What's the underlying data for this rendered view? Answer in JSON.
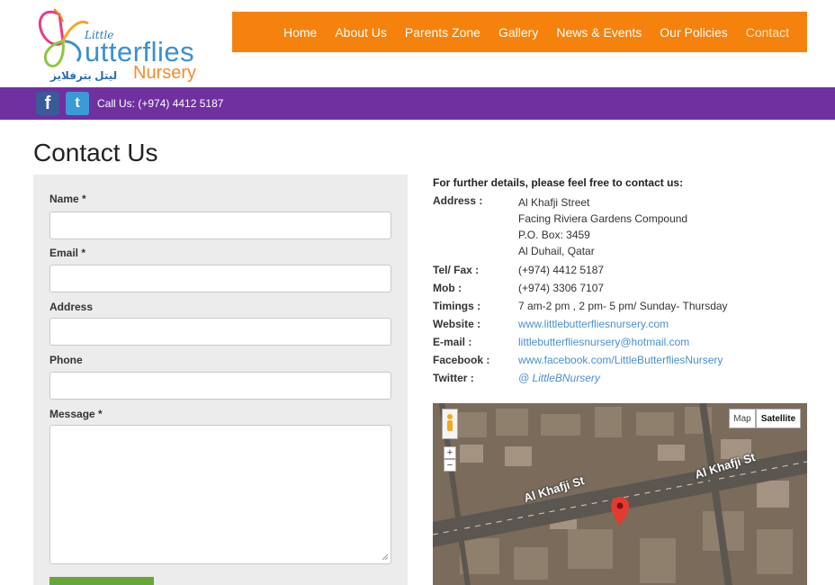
{
  "logo": {
    "little": "Little",
    "butterflies": "utterflies",
    "nursery": "Nursery",
    "arabic": "ليتل بترفلايز"
  },
  "nav": {
    "items": [
      {
        "label": "Home"
      },
      {
        "label": "About Us"
      },
      {
        "label": "Parents Zone"
      },
      {
        "label": "Gallery"
      },
      {
        "label": "News & Events"
      },
      {
        "label": "Our Policies"
      },
      {
        "label": "Contact"
      }
    ]
  },
  "topbar": {
    "call_us": "Call Us: (+974) 4412 5187",
    "facebook_icon": "facebook-icon",
    "twitter_icon": "twitter-icon"
  },
  "page": {
    "title": "Contact Us"
  },
  "form": {
    "name_label": "Name *",
    "email_label": "Email *",
    "address_label": "Address",
    "phone_label": "Phone",
    "message_label": "Message *"
  },
  "contact": {
    "heading": "For further details, please feel free to contact us:",
    "address_key": "Address :",
    "address_lines": [
      "Al Khafji Street",
      "Facing Riviera Gardens Compound",
      "P.O. Box: 3459",
      "Al Duhail, Qatar"
    ],
    "rows": [
      {
        "key": "Tel/ Fax :",
        "value": "(+974) 4412 5187"
      },
      {
        "key": "Mob :",
        "value": "(+974) 3306 7107"
      },
      {
        "key": "Timings :",
        "value": "7 am-2 pm , 2 pm- 5 pm/ Sunday- Thursday"
      },
      {
        "key": "Website :",
        "value": "www.littlebutterfliesnursery.com"
      },
      {
        "key": "E-mail :",
        "value": "littlebutterfliesnursery@hotmail.com"
      },
      {
        "key": "Facebook :",
        "value": "www.facebook.com/LittleButterfliesNursery"
      },
      {
        "key": "Twitter :",
        "value": "@ LittleBNursery"
      }
    ]
  },
  "map": {
    "map_label": "Map",
    "satellite_label": "Satellite",
    "zoom_in": "+",
    "zoom_out": "−",
    "street_1": "Al Khafji St",
    "street_2": "Al Khafji St"
  },
  "colors": {
    "nav_bg": "#f5820d",
    "topbar_bg": "#7030a0",
    "link": "#4a8fcf",
    "button": "#6aa53a"
  }
}
